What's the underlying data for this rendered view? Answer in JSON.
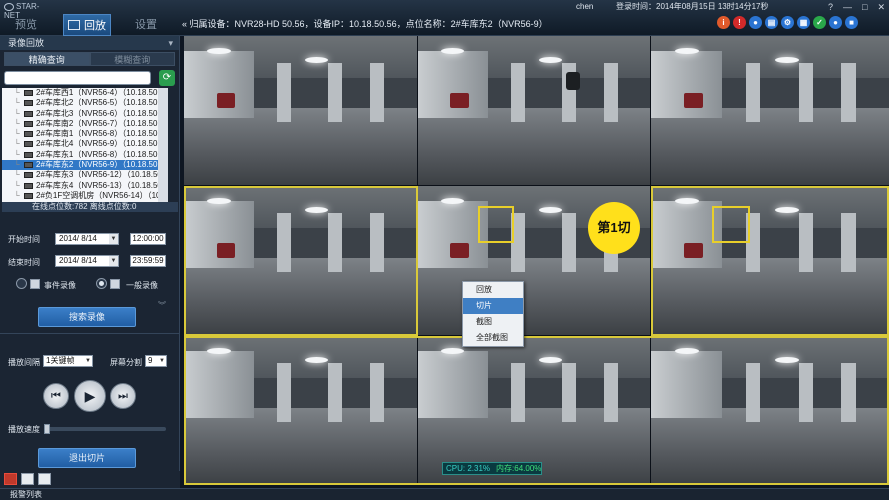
{
  "app": {
    "logo_text": "STAR-NET",
    "nav_tabs": [
      "预览",
      "回放",
      "设置"
    ],
    "active_tab": "回放",
    "user": "chen",
    "login_time": "登录时间：2014年08月15日 13时14分17秒",
    "win_buttons": [
      "?",
      "—",
      "□",
      "✕"
    ]
  },
  "info_bar": {
    "text": "« 归属设备：NVR28-HD 50.56，设备IP：10.18.50.56，点位名称：2#车库东2（NVR56-9）"
  },
  "toolbar_icons": [
    {
      "name": "info-icon",
      "glyph": "i",
      "color": "#e05a2b"
    },
    {
      "name": "alarm-icon",
      "glyph": "!",
      "color": "#d22a2a"
    },
    {
      "name": "location-icon",
      "glyph": "●",
      "color": "#2a74d2"
    },
    {
      "name": "monitor-icon",
      "glyph": "▤",
      "color": "#2a74d2"
    },
    {
      "name": "gear-icon",
      "glyph": "⚙",
      "color": "#2a74d2"
    },
    {
      "name": "grid-icon",
      "glyph": "▦",
      "color": "#2a74d2"
    },
    {
      "name": "check-icon",
      "glyph": "✓",
      "color": "#2aa84a"
    },
    {
      "name": "user-icon",
      "glyph": "●",
      "color": "#2a74d2"
    },
    {
      "name": "lock-icon",
      "glyph": "■",
      "color": "#2a74d2"
    }
  ],
  "sidebar": {
    "title": "录像回放",
    "collapse_glyph": "▾",
    "tabs": [
      "精确查询",
      "模糊查询"
    ],
    "active_tab": "精确查询",
    "search": {
      "value": "",
      "placeholder": ""
    },
    "refresh_glyph": "⟳",
    "devices": [
      {
        "label": "2#车库西1（NVR56-4）（10.18.50.5",
        "selected": false
      },
      {
        "label": "2#车库北2（NVR56-5）（10.18.50.5",
        "selected": false
      },
      {
        "label": "2#车库北3（NVR56-6）（10.18.50.5",
        "selected": false
      },
      {
        "label": "2#车库南2（NVR56-7）（10.18.50.5",
        "selected": false
      },
      {
        "label": "2#车库南1（NVR56-8）（10.18.50.5",
        "selected": false
      },
      {
        "label": "2#车库北4（NVR56-9）（10.18.50.5",
        "selected": false
      },
      {
        "label": "2#车库东1（NVR56-8）（10.18.50.5",
        "selected": false
      },
      {
        "label": "2#车库东2（NVR56-9）（10.18.50.5",
        "selected": true
      },
      {
        "label": "2#车库东3（NVR56-12）（10.18.50.",
        "selected": false
      },
      {
        "label": "2#车库东4（NVR56-13）（10.18.50.",
        "selected": false
      },
      {
        "label": "2#负1F空调机房（NVR56-14）（10.1",
        "selected": false
      }
    ],
    "online_status": "在线点位数:782 离线点位数:0",
    "start_label": "开始时间",
    "start_date": "2014/ 8/14",
    "start_time": "12:00:00",
    "end_label": "结束时间",
    "end_date": "2014/ 8/14",
    "end_time": "23:59:59",
    "event_record": "事件录像",
    "normal_record": "一般录像",
    "search_button": "搜索录像",
    "play_interval_label": "播放间隔",
    "play_interval_value": "1关键帧",
    "screen_split_label": "屏幕分割",
    "screen_split_value": "9",
    "play_speed_label": "播放速度",
    "play_speed_level": 0.0,
    "exit_clip_button": "退出切片"
  },
  "video": {
    "badge": "第1切",
    "cpu": "CPU: 2.31%",
    "mem": "内存:64.00%"
  },
  "context_menu": [
    "回放",
    "切片",
    "截图",
    "全部截图"
  ],
  "context_highlight": "切片",
  "alarm_list": "报警列表"
}
